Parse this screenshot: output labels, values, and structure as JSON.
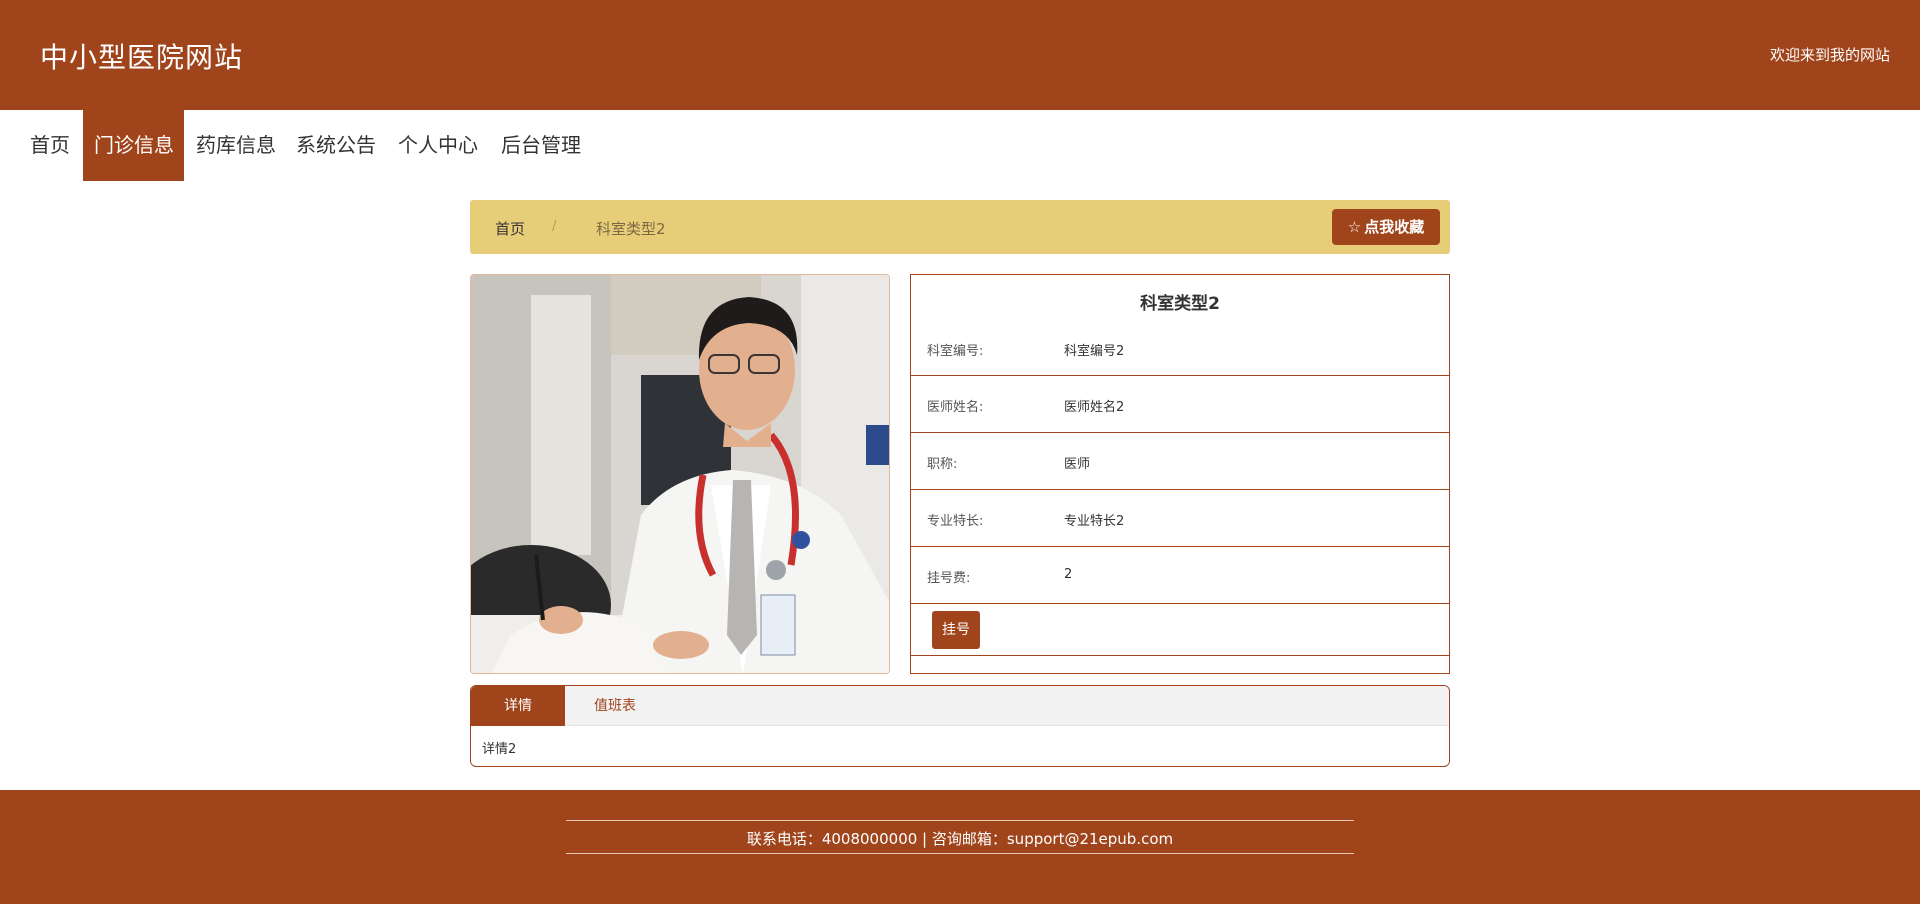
{
  "header": {
    "site_title": "中小型医院网站",
    "welcome": "欢迎来到我的网站"
  },
  "nav": {
    "items": [
      {
        "label": "首页",
        "active": false
      },
      {
        "label": "门诊信息",
        "active": true
      },
      {
        "label": "药库信息",
        "active": false
      },
      {
        "label": "系统公告",
        "active": false
      },
      {
        "label": "个人中心",
        "active": false
      },
      {
        "label": "后台管理",
        "active": false
      }
    ]
  },
  "breadcrumb": {
    "home": "首页",
    "separator": "/",
    "current": "科室类型2",
    "favorite_label": "点我收藏",
    "favorite_icon": "star-outline-icon"
  },
  "detail": {
    "title": "科室类型2",
    "rows": [
      {
        "label": "科室编号:",
        "value": "科室编号2"
      },
      {
        "label": "医师姓名:",
        "value": "医师姓名2"
      },
      {
        "label": "职称:",
        "value": "医师"
      },
      {
        "label": "专业特长:",
        "value": "专业特长2"
      },
      {
        "label": "挂号费:",
        "value": "2"
      }
    ],
    "register_label": "挂号"
  },
  "tabs": {
    "items": [
      {
        "label": "详情",
        "active": true
      },
      {
        "label": "值班表",
        "active": false
      }
    ],
    "content": "详情2"
  },
  "footer": {
    "contact": "联系电话：4008000000 | 咨询邮箱：support@21epub.com"
  },
  "colors": {
    "brand": "#a0441c",
    "breadcrumb_bg": "#e8cd79"
  }
}
